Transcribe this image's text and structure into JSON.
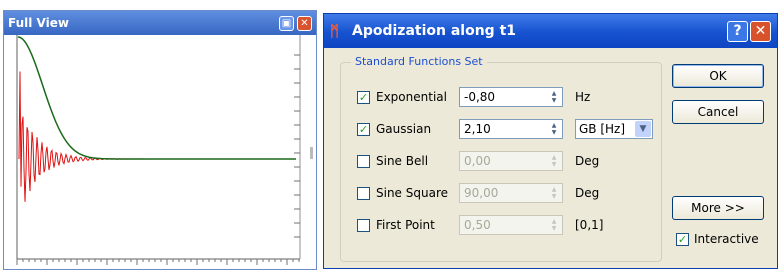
{
  "full_view": {
    "title": "Full View",
    "icons": [
      "window-menu-icon",
      "close-icon"
    ]
  },
  "dialog": {
    "title": "Apodization along t1",
    "help_label": "?",
    "close_label": "✕",
    "group_title": "Standard Functions Set",
    "functions": [
      {
        "label": "Exponential",
        "checked": true,
        "enabled": true,
        "value": "-0,80",
        "unit": "Hz"
      },
      {
        "label": "Gaussian",
        "checked": true,
        "enabled": true,
        "value": "2,10",
        "unit_select": "GB [Hz]"
      },
      {
        "label": "Sine Bell",
        "checked": false,
        "enabled": false,
        "value": "0,00",
        "unit": "Deg"
      },
      {
        "label": "Sine Square",
        "checked": false,
        "enabled": false,
        "value": "90,00",
        "unit": "Deg"
      },
      {
        "label": "First Point",
        "checked": false,
        "enabled": false,
        "value": "0,50",
        "unit": "[0,1]"
      }
    ],
    "ok_label": "OK",
    "cancel_label": "Cancel",
    "more_label": "More >>",
    "interactive_label": "Interactive",
    "interactive_checked": true
  },
  "colors": {
    "fid_curve": "#e01010",
    "decay_curve": "#1a6a1a",
    "axis": "#606060",
    "title_bar": "#1752d0"
  }
}
